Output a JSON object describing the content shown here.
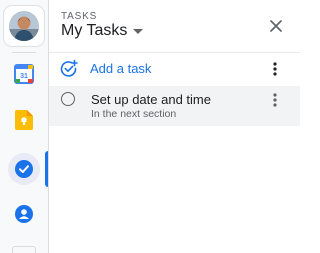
{
  "panel": {
    "eyebrow": "TASKS",
    "title": "My Tasks"
  },
  "add_task": {
    "label": "Add a task"
  },
  "tasks": [
    {
      "title": "Set up date and time",
      "subtitle": "In the next section",
      "completed": false
    }
  ],
  "rail": {
    "items": [
      {
        "name": "calendar-icon",
        "active": false
      },
      {
        "name": "keep-icon",
        "active": false
      },
      {
        "name": "tasks-icon",
        "active": true
      },
      {
        "name": "contacts-icon",
        "active": false
      }
    ],
    "calendar_day": "31"
  },
  "colors": {
    "accent": "#1a73e8",
    "calendar_blue": "#4285f4",
    "calendar_green": "#34a853",
    "calendar_yellow": "#fbbc04",
    "calendar_red": "#ea4335",
    "keep_yellow": "#fbbc04",
    "contacts_blue": "#1a73e8",
    "text_primary": "#202124",
    "text_secondary": "#5f6368"
  }
}
